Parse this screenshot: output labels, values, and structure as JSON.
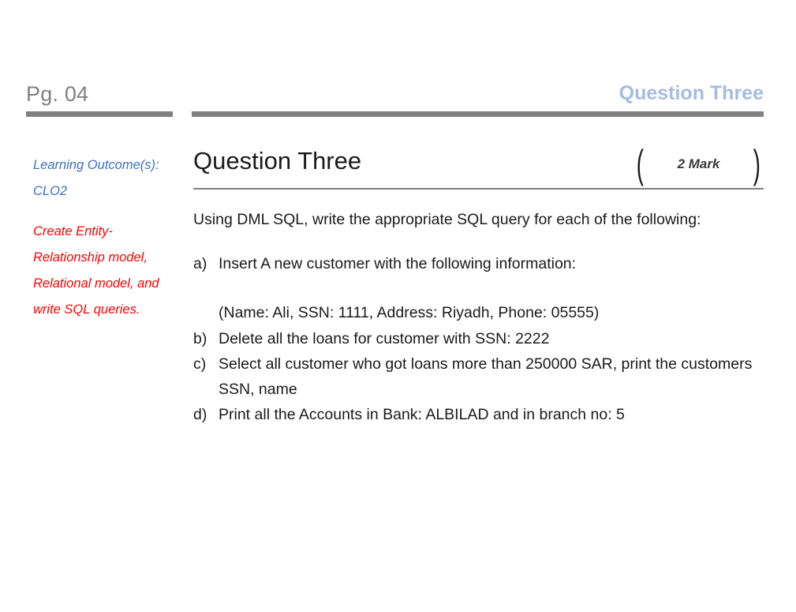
{
  "header": {
    "page_label": "Pg. 04",
    "title": "Question Three",
    "title_color": "#a5bce2",
    "rule_color": "#808080"
  },
  "sidebar": {
    "learning_outcome_heading": "Learning Outcome(s): CLO2",
    "learning_outcome_heading_color": "#3d6fc4",
    "learning_outcome_body": "Create Entity-Relationship model, Relational model, and write SQL queries.",
    "learning_outcome_body_color": "#ff0000"
  },
  "main": {
    "question_title": "Question Three",
    "mark_badge": {
      "bracket_left": "(",
      "bracket_right": ")",
      "label": "2 Mark"
    },
    "intro": "Using DML SQL, write the appropriate SQL query for each of the following:",
    "items": [
      {
        "marker": "a)",
        "text": "Insert A new customer with the following information:",
        "sub": "(Name: Ali, SSN: 1111, Address: Riyadh, Phone: 05555)"
      },
      {
        "marker": "b)",
        "text": "Delete all the loans for customer with SSN: 2222",
        "sub": ""
      },
      {
        "marker": "c)",
        "text": "Select all customer who got loans more than 250000 SAR, print the customers SSN, name",
        "sub": ""
      },
      {
        "marker": "d)",
        "text": "Print all the Accounts in Bank: ALBILAD and in branch no: 5",
        "sub": ""
      }
    ]
  }
}
